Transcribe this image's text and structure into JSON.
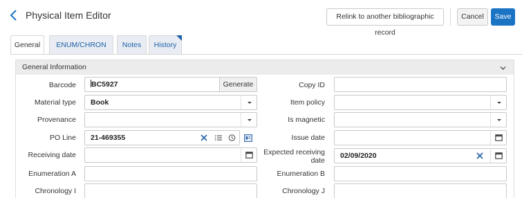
{
  "header": {
    "title": "Physical Item Editor",
    "relink_label": "Relink to another bibliographic record",
    "cancel_label": "Cancel",
    "save_label": "Save"
  },
  "tabs": [
    {
      "label": "General",
      "active": true
    },
    {
      "label": "ENUM/CHRON",
      "active": false
    },
    {
      "label": "Notes",
      "active": false
    },
    {
      "label": "History",
      "active": false
    }
  ],
  "section": {
    "title": "General Information"
  },
  "fields": {
    "barcode": {
      "label": "Barcode",
      "value": "BC5927",
      "generate_label": "Generate"
    },
    "material_type": {
      "label": "Material type",
      "value": "Book"
    },
    "provenance": {
      "label": "Provenance",
      "value": ""
    },
    "po_line": {
      "label": "PO Line",
      "value": "21-469355"
    },
    "receiving_date": {
      "label": "Receiving date",
      "value": ""
    },
    "enumeration_a": {
      "label": "Enumeration A",
      "value": ""
    },
    "chronology_i": {
      "label": "Chronology I",
      "value": ""
    },
    "copy_id": {
      "label": "Copy ID",
      "value": ""
    },
    "item_policy": {
      "label": "Item policy",
      "value": ""
    },
    "is_magnetic": {
      "label": "Is magnetic",
      "value": ""
    },
    "issue_date": {
      "label": "Issue date",
      "value": ""
    },
    "expected_receiving_date": {
      "label_line1": "Expected receiving",
      "label_line2": "date",
      "value": "02/09/2020"
    },
    "enumeration_b": {
      "label": "Enumeration B",
      "value": ""
    },
    "chronology_j": {
      "label": "Chronology J",
      "value": ""
    }
  },
  "colors": {
    "accent": "#1b73c4",
    "tab_link": "#1b5fa8",
    "section_bg": "#ececec"
  }
}
